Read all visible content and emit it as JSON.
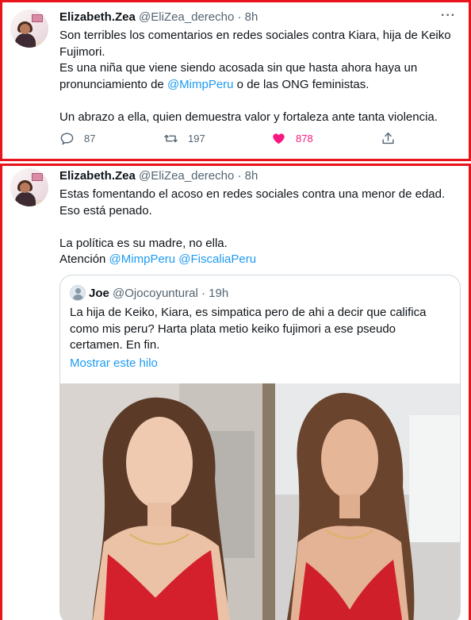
{
  "tweets": [
    {
      "author_name": "Elizabeth.Zea",
      "handle": "@EliZea_derecho",
      "separator": "·",
      "time": "8h",
      "more_icon": "more-dots-icon",
      "lines": {
        "l1": "Son terribles los comentarios en redes sociales contra Kiara, hija de Keiko",
        "l2": "Fujimori.",
        "l3": "Es una niña que viene siendo acosada sin que hasta ahora haya un",
        "l4_a": "pronunciamiento de ",
        "l4_link": "@MimpPeru",
        "l4_b": " o de las ONG feministas.",
        "l5": "Un abrazo a ella, quien demuestra valor y fortaleza ante tanta violencia."
      },
      "actions": {
        "reply_count": "87",
        "retweet_count": "197",
        "like_count": "878"
      }
    },
    {
      "author_name": "Elizabeth.Zea",
      "handle": "@EliZea_derecho",
      "separator": "·",
      "time": "8h",
      "more_icon": "more-dots-icon",
      "lines": {
        "l1": "Estas fomentando el acoso en redes sociales contra una menor de edad.",
        "l2": "Eso está penado.",
        "l3": "La política es su madre, no ella.",
        "l4_a": "Atención ",
        "l4_link1": "@MimpPeru",
        "l4_sp": " ",
        "l4_link2": "@FiscaliaPeru"
      },
      "quote": {
        "author_name": "Joe",
        "handle": "@Ojocoyuntural",
        "separator": "·",
        "time": "19h",
        "l1": "La hija de Keiko, Kiara, es simpatica pero de ahi a decir que califica",
        "l2": "como mis peru? Harta plata metio keiko fujimori a ese pseudo",
        "l3": "certamen. En fin.",
        "show_thread": "Mostrar este hilo"
      }
    }
  ],
  "colors": {
    "highlight_border": "#e8141c",
    "link": "#1d9bf0",
    "like": "#f91880",
    "muted": "#536471"
  }
}
